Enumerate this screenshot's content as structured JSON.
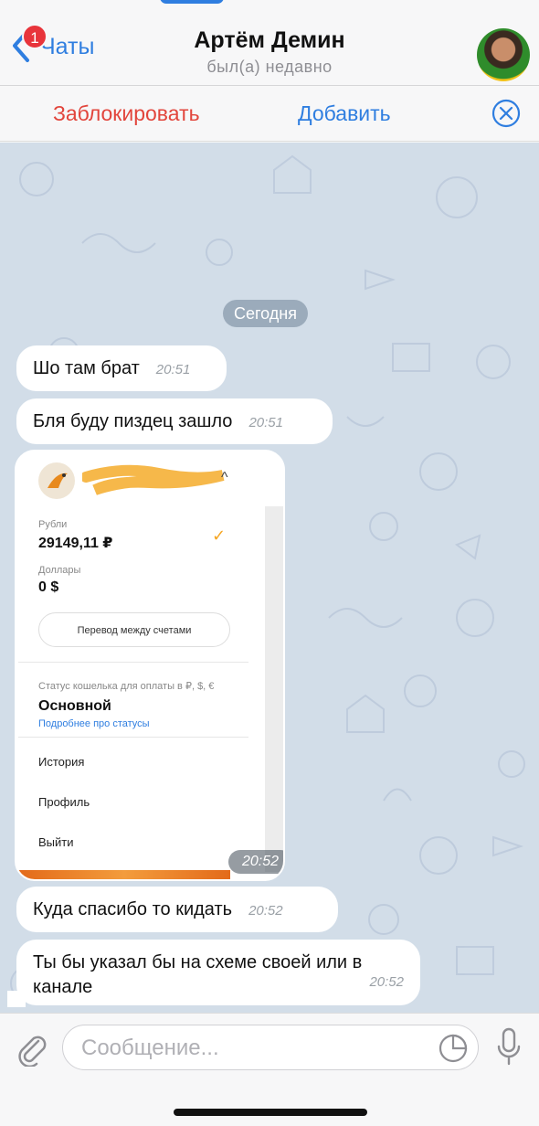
{
  "header": {
    "back_label": "Чаты",
    "unread_count": "1",
    "title": "Артём Демин",
    "subtitle": "был(а) недавно"
  },
  "actions": {
    "block_label": "Заблокировать",
    "add_label": "Добавить"
  },
  "chat": {
    "date_label": "Сегодня",
    "messages": [
      {
        "text": "Шо там брат",
        "time": "20:51"
      },
      {
        "text": "Бля буду пиздец зашло",
        "time": "20:51"
      },
      {
        "time": "20:52"
      },
      {
        "text": "Куда спасибо то кидать",
        "time": "20:52"
      },
      {
        "text": "Ты бы указал бы на схеме своей или в канале",
        "time": "20:52"
      }
    ]
  },
  "screenshot": {
    "rub_label": "Рубли",
    "rub_value": "29149,11 ₽",
    "usd_label": "Доллары",
    "usd_value": "0 $",
    "transfer_button": "Перевод между счетами",
    "status_label": "Статус кошелька для оплаты в ₽, $, €",
    "status_value": "Основной",
    "status_link": "Подробнее про статусы",
    "menu": [
      "История",
      "Профиль",
      "Выйти"
    ]
  },
  "input": {
    "placeholder": "Сообщение..."
  },
  "colors": {
    "accent": "#2f7ee0",
    "danger": "#e2453c",
    "chat_bg": "#d2dde8"
  }
}
